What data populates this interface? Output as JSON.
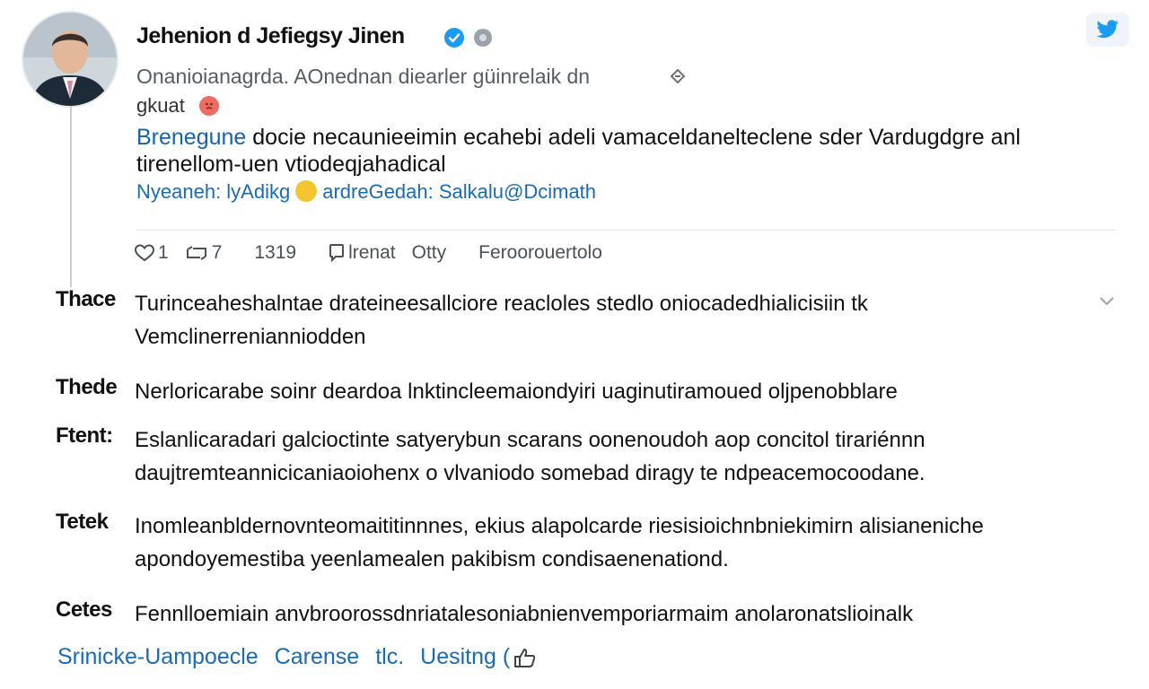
{
  "user": {
    "display_name": "Jehenion d Jefiegsy Jinen",
    "handle_line": "Onanioianagrda. AOnednan diearler güinrelaik dn",
    "sub_line": "gkuat"
  },
  "post": {
    "body_link": "Brenegune",
    "body_rest": "docie necaunieeimin ecahebi adeli vamaceldanelteclene sder Vardugdgre anl tirenellom-uen vtiodeqjahadical",
    "tag_prefix": "Nyeaneh: lyAdikg",
    "tag_suffix": "ardreGedah: Salkalu@Dcimath"
  },
  "actions": {
    "likes": "1",
    "retweets": "7",
    "views": "1319",
    "reply_label": "lrenat",
    "reply_extra": "Otty",
    "more_label": "Feroorouertolo"
  },
  "thread_rows": [
    {
      "label": "Thace",
      "text": "Turinceaheshalntae drateineesallciore reacloles stedlo oniocadedhialicisiin tk Vemclinerrenianniodden"
    },
    {
      "label": "Thede",
      "text": "Nerloricarabe soinr deardoa lnktincleemaiondyiri uaginutiramoued oljpenobblare"
    },
    {
      "label": "Ftent:",
      "text": "Eslanlicaradari galcioctinte satyerybun scarans oonenoudoh aop concitol tirariénnn daujtremteannicicaniaoiohenx o vlvaniodo somebad diragy te ndpeacemocoodane."
    },
    {
      "label": "Tetek",
      "text": "Inomleanbldernovnteomaititinnnes, ekius alapolcarde riesisioichnbniekimirn alisianeniche apondoyemestiba yeenlamealen pakibism condisaenenationd."
    },
    {
      "label": "Cetes",
      "text": "Fennlloemiain anvbroorossdnriatalesoniabnienvemporiarmaim anolaronatslioinalk"
    }
  ],
  "footer": {
    "link1": "Srinicke-Uampoecle",
    "link2": "Carense",
    "link3": "tlc.",
    "link4": "Uesitng ("
  },
  "colors": {
    "accent": "#1a6bb5",
    "verified": "#1d9bf0",
    "twitter": "#1d9bf0",
    "text": "#111111",
    "muted": "#555c63"
  },
  "icons": {
    "verified": "verified-badge-icon",
    "twitter": "twitter-bird-icon",
    "like": "heart-icon",
    "retweet": "retweet-icon",
    "reply": "reply-bubble-icon",
    "chevron": "chevron-down-icon",
    "footer_like": "thumbs-up-icon"
  }
}
